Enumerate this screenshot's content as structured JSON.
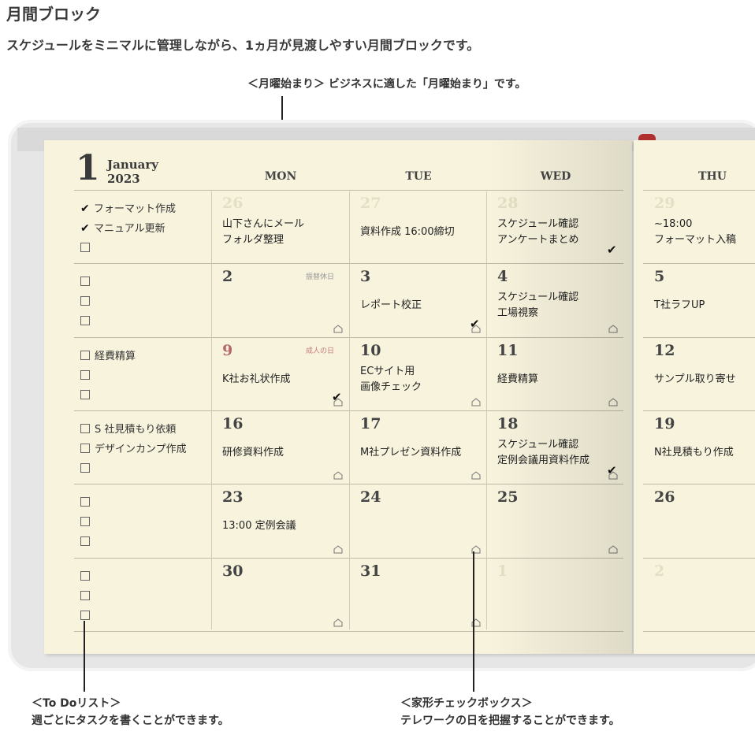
{
  "header": {
    "title": "月間ブロック",
    "description": "スケジュールをミニマルに管理しながら、1ヵ月が見渡しやすい月間ブロックです。"
  },
  "annotations": {
    "monday_start": "＜月曜始まり＞ ビジネスに適した「月曜始まり」です。",
    "todo_title": "＜To Doリスト＞",
    "todo_text": "週ごとにタスクを書くことができます。",
    "house_title": "＜家形チェックボックス＞",
    "house_text": "テレワークの日を把握することができます。"
  },
  "planner": {
    "month_number": "1",
    "month_name": "January",
    "year": "2023",
    "weekdays": [
      "MON",
      "TUE",
      "WED",
      "THU"
    ],
    "todos": [
      [
        {
          "label": "フォーマット作成",
          "checked": true
        },
        {
          "label": "マニュアル更新",
          "checked": true
        },
        {
          "label": "",
          "checked": false
        }
      ],
      [
        {
          "label": "",
          "checked": false
        },
        {
          "label": "",
          "checked": false
        },
        {
          "label": "",
          "checked": false
        }
      ],
      [
        {
          "label": "経費精算",
          "checked": false
        },
        {
          "label": "",
          "checked": false
        },
        {
          "label": "",
          "checked": false
        }
      ],
      [
        {
          "label": "S 社見積もり依頼",
          "checked": false
        },
        {
          "label": "デザインカンプ作成",
          "checked": false
        },
        {
          "label": "",
          "checked": false
        }
      ],
      [
        {
          "label": "",
          "checked": false
        },
        {
          "label": "",
          "checked": false
        },
        {
          "label": "",
          "checked": false
        }
      ],
      [
        {
          "label": "",
          "checked": false
        },
        {
          "label": "",
          "checked": false
        },
        {
          "label": "",
          "checked": false
        }
      ]
    ],
    "weeks": [
      [
        {
          "day": "26",
          "faded": true,
          "notes": [
            "山下さんにメール",
            "フォルダ整理"
          ],
          "house": false,
          "tick": false
        },
        {
          "day": "27",
          "faded": true,
          "notes": [
            "資料作成 16:00締切"
          ],
          "house": false,
          "tick": false
        },
        {
          "day": "28",
          "faded": true,
          "notes": [
            "スケジュール確認",
            "アンケートまとめ"
          ],
          "house": false,
          "tick": true
        },
        {
          "day": "29",
          "faded": true,
          "notes": [
            "~18:00",
            "フォーマット入稿"
          ],
          "house": false,
          "tick": false
        }
      ],
      [
        {
          "day": "2",
          "holiday_name": "振替休日",
          "notes": [],
          "house": true,
          "tick": false
        },
        {
          "day": "3",
          "notes": [
            "レポート校正"
          ],
          "house": true,
          "tick": true
        },
        {
          "day": "4",
          "notes": [
            "スケジュール確認",
            "工場視察"
          ],
          "house": true,
          "tick": false
        },
        {
          "day": "5",
          "notes": [
            "T社ラフUP"
          ],
          "house": false,
          "tick": false
        }
      ],
      [
        {
          "day": "9",
          "holiday": true,
          "holiday_name": "成人の日",
          "notes": [
            "K社お礼状作成"
          ],
          "house": true,
          "tick": true
        },
        {
          "day": "10",
          "notes": [
            "ECサイト用",
            "画像チェック"
          ],
          "house": true,
          "tick": false
        },
        {
          "day": "11",
          "notes": [
            "経費精算"
          ],
          "house": true,
          "tick": false
        },
        {
          "day": "12",
          "notes": [
            "サンプル取り寄せ"
          ],
          "house": false,
          "tick": false
        }
      ],
      [
        {
          "day": "16",
          "notes": [
            "研修資料作成"
          ],
          "house": true,
          "tick": false
        },
        {
          "day": "17",
          "notes": [
            "M社プレゼン資料作成"
          ],
          "house": true,
          "tick": false
        },
        {
          "day": "18",
          "notes": [
            "スケジュール確認",
            "定例会議用資料作成"
          ],
          "house": true,
          "tick": true
        },
        {
          "day": "19",
          "notes": [
            "N社見積もり作成"
          ],
          "house": false,
          "tick": false
        }
      ],
      [
        {
          "day": "23",
          "notes": [
            "13:00 定例会議"
          ],
          "house": true,
          "tick": false
        },
        {
          "day": "24",
          "notes": [],
          "house": true,
          "tick": false
        },
        {
          "day": "25",
          "notes": [],
          "house": true,
          "tick": false
        },
        {
          "day": "26",
          "notes": [],
          "house": false,
          "tick": false
        }
      ],
      [
        {
          "day": "30",
          "notes": [],
          "house": true,
          "tick": false
        },
        {
          "day": "31",
          "notes": [],
          "house": true,
          "tick": false
        },
        {
          "day": "1",
          "faded": true,
          "notes": [],
          "house": false,
          "tick": false
        },
        {
          "day": "2",
          "faded": true,
          "notes": [],
          "house": false,
          "tick": false
        }
      ]
    ]
  }
}
